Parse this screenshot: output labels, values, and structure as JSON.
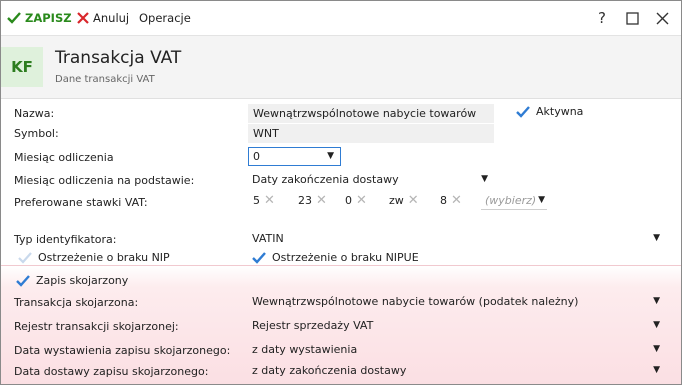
{
  "toolbar": {
    "save_label": "ZAPISZ",
    "cancel_label": "Anuluj",
    "operations_label": "Operacje"
  },
  "window_controls": {
    "help": "?"
  },
  "header": {
    "badge": "KF",
    "title": "Transakcja VAT",
    "subtitle": "Dane transakcji VAT"
  },
  "form": {
    "name_label": "Nazwa:",
    "name_value": "Wewnątrzwspólnotowe nabycie towarów",
    "active_label": "Aktywna",
    "symbol_label": "Symbol:",
    "symbol_value": "WNT",
    "month_label": "Miesiąc odliczenia",
    "month_value": "0",
    "month_basis_label": "Miesiąc odliczenia na podstawie:",
    "month_basis_value": "Daty zakończenia dostawy",
    "rates_label": "Preferowane stawki VAT:",
    "rates": [
      "5",
      "23",
      "0",
      "zw",
      "8"
    ],
    "rates_select_placeholder": "(wybierz)",
    "id_type_label": "Typ identyfikatora:",
    "id_type_value": "VATIN",
    "nip_warning_label": "Ostrzeżenie o braku NIP",
    "nipue_warning_label": "Ostrzeżenie o braku NIPUE"
  },
  "linked": {
    "checkbox_label": "Zapis skojarzony",
    "transaction_label": "Transakcja skojarzona:",
    "transaction_value": "Wewnątrzwspólnotowe nabycie towarów (podatek należny)",
    "register_label": "Rejestr transakcji skojarzonej:",
    "register_value": "Rejestr sprzedaży VAT",
    "issue_date_label": "Data wystawienia zapisu skojarzonego:",
    "issue_date_value": "z daty wystawienia",
    "delivery_date_label": "Data dostawy zapisu skojarzonego:",
    "delivery_date_value": "z daty zakończenia dostawy"
  },
  "colors": {
    "accent_green": "#2a8a1c",
    "cancel_red": "#d9262b",
    "check_blue": "#2f7cd3",
    "linked_section_bg": "#fbdfe3"
  },
  "icons": {
    "save": "check-icon",
    "cancel": "x-icon",
    "dropdown": "chevron-down-icon",
    "remove_rate": "x-icon"
  }
}
